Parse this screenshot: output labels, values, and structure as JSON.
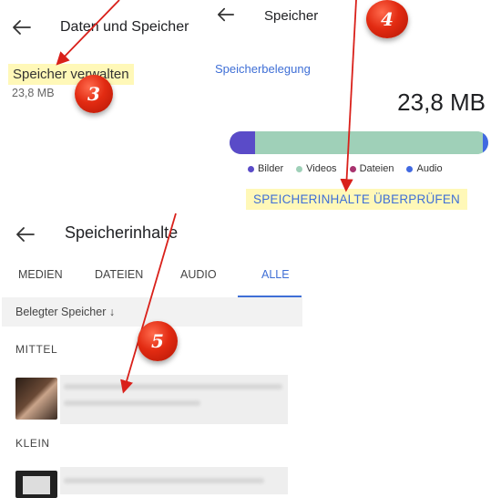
{
  "panel1": {
    "back_icon": "arrow-left-icon",
    "title": "Daten und Speicher",
    "manage_storage": "Speicher verwalten",
    "size": "23,8 MB"
  },
  "panel2": {
    "back_icon": "arrow-left-icon",
    "title": "Speicher",
    "usage_label": "Speicherbelegung",
    "total": "23,8 MB",
    "bar_fractions": {
      "bilder": 0.1,
      "videos": 0.88,
      "dateien": 0.0,
      "audio": 0.02
    },
    "legend": [
      {
        "label": "Bilder",
        "color": "#5a4bc8"
      },
      {
        "label": "Videos",
        "color": "#9fd0b8"
      },
      {
        "label": "Dateien",
        "color": "#a8336f"
      },
      {
        "label": "Audio",
        "color": "#4169e1"
      }
    ],
    "review_button": "SPEICHERINHALTE ÜBERPRÜFEN"
  },
  "panel3": {
    "back_icon": "arrow-left-icon",
    "title": "Speicherinhalte",
    "tabs": [
      {
        "label": "MEDIEN"
      },
      {
        "label": "DATEIEN"
      },
      {
        "label": "AUDIO"
      },
      {
        "label": "ALLE"
      }
    ],
    "active_tab": "ALLE",
    "filter_label": "Belegter Speicher ↓",
    "sections": [
      {
        "label": "MITTEL"
      },
      {
        "label": "KLEIN"
      }
    ]
  },
  "badges": [
    "3",
    "4",
    "5"
  ],
  "colors": {
    "accent": "#3f6fd6",
    "highlight": "#fff8b8",
    "badge": "#e22b12",
    "arrow": "#d9201a"
  }
}
